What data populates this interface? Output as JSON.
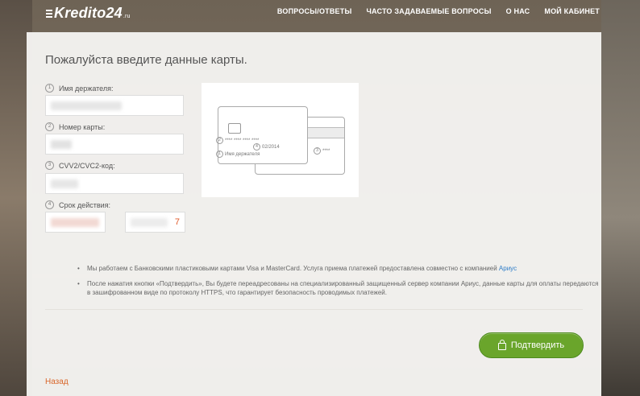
{
  "header": {
    "logo_text": "Kredito24",
    "logo_domain": ".ru",
    "nav": [
      "ВОПРОСЫ/ОТВЕТЫ",
      "ЧАСТО ЗАДАВАЕМЫЕ ВОПРОСЫ",
      "О НАС",
      "МОЙ КАБИНЕТ"
    ]
  },
  "form": {
    "title": "Пожалуйста введите данные карты.",
    "fields": [
      {
        "num": "1",
        "label": "Имя держателя:"
      },
      {
        "num": "2",
        "label": "Номер карты:"
      },
      {
        "num": "3",
        "label": "CVV2/CVC2-код:"
      },
      {
        "num": "4",
        "label": "Срок действия:"
      }
    ],
    "expiry_year_visible": "7"
  },
  "card_illustration": {
    "number_mask": "**** **** **** ****",
    "expiry": "02/2014",
    "holder": "Имя держателя",
    "cvv_mask": "****",
    "nums": [
      "1",
      "2",
      "3",
      "4"
    ]
  },
  "notes": {
    "note1_text": "Мы работаем с Банковскими пластиковыми картами Visa и MasterCard. Услуга приема платежей предоставлена совместно с компанией ",
    "note1_link": "Ариус",
    "note2_text": "После нажатия кнопки «Подтвердить», Вы будете переадресованы на специализированный защищенный сервер компании Ариус, данные карты для оплаты передаются в зашифрованном виде по протоколу HTTPS, что гарантирует безопасность проводимых платежей."
  },
  "actions": {
    "confirm_label": "Подтвердить",
    "back_label": "Назад"
  },
  "colors": {
    "confirm_green": "#6aa52b",
    "link_blue": "#2f7dc8",
    "back_orange": "#d9662a"
  }
}
